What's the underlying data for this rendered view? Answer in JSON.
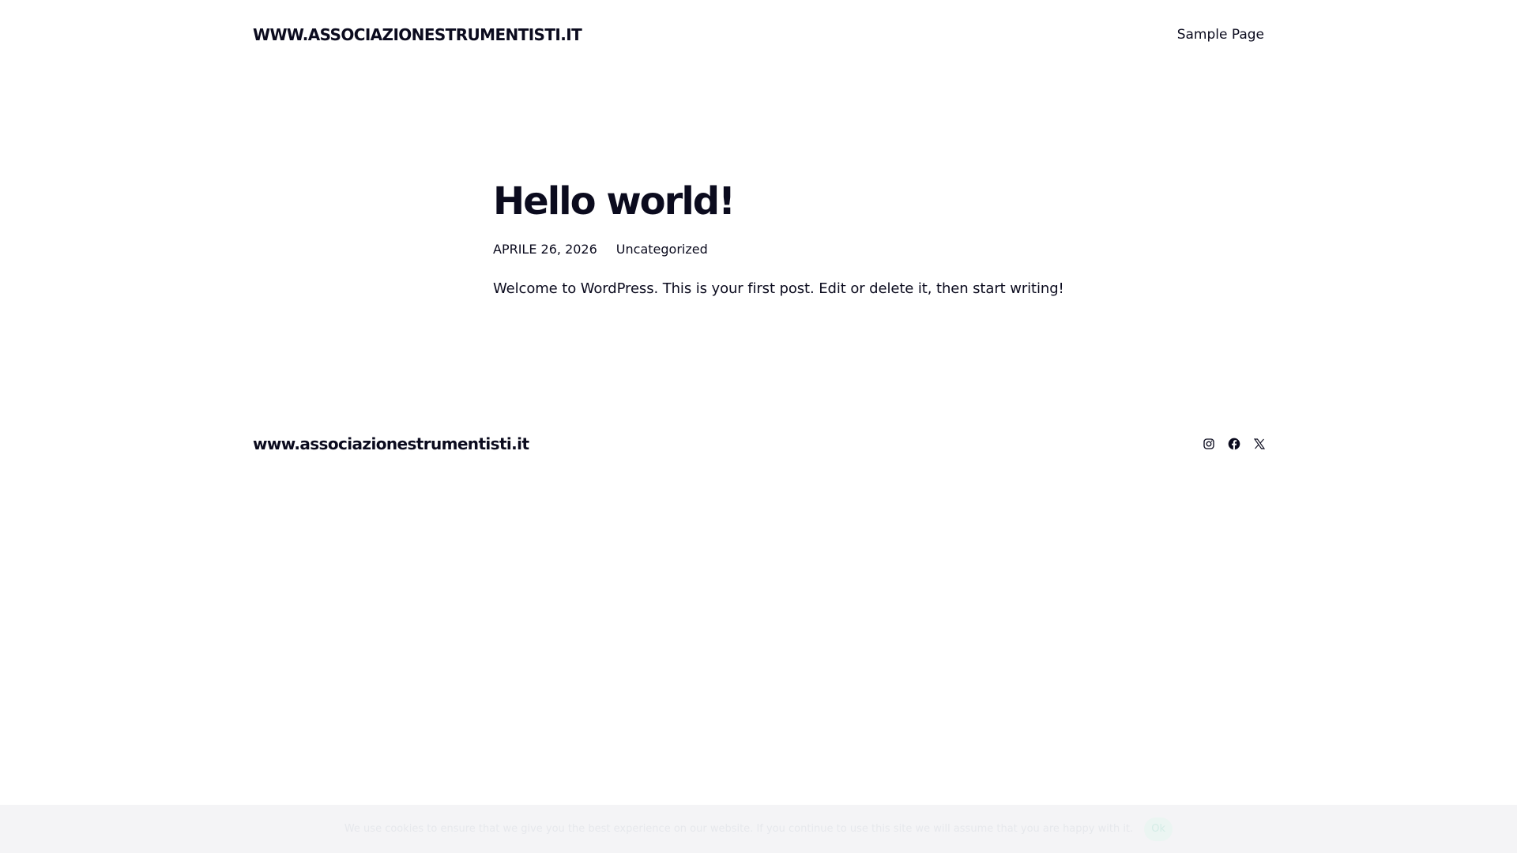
{
  "header": {
    "site_title": "WWW.ASSOCIAZIONESTRUMENTISTI.IT",
    "nav": [
      {
        "label": "Sample Page"
      }
    ]
  },
  "post": {
    "title": "Hello world!",
    "date": "APRILE 26, 2026",
    "category": "Uncategorized",
    "content": "Welcome to WordPress. This is your first post. Edit or delete it, then start writing!"
  },
  "footer": {
    "site_title": "www.associazionestrumentisti.it",
    "social": [
      {
        "icon": "instagram-icon"
      },
      {
        "icon": "facebook-icon"
      },
      {
        "icon": "x-icon"
      }
    ]
  },
  "cookie_bar": {
    "text": "We use cookies to ensure that we give you the best experience on our website. If you continue to use this site we will assume that you are happy with it.",
    "ok_label": "Ok"
  },
  "colors": {
    "text": "#0b0b1e",
    "background": "#ffffff",
    "cookie_bar_bg": "#f4f4f6"
  }
}
